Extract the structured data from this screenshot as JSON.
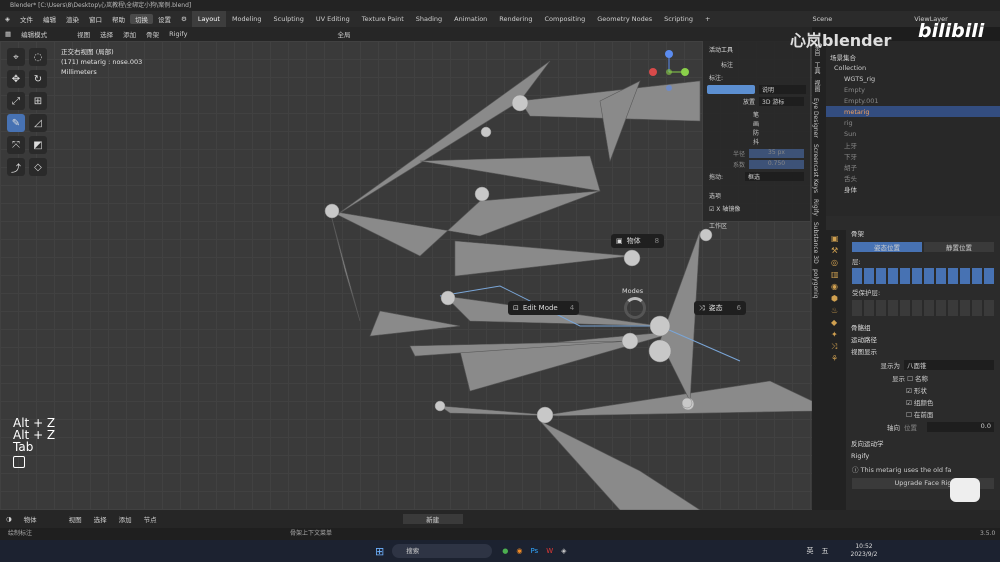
{
  "title": "Blender* [C:\\Users\\8\\Desktop\\心岚教程\\全绑定小狗\\案例.blend]",
  "menus": [
    "文件",
    "编辑",
    "渲染",
    "窗口",
    "帮助"
  ],
  "active_menu": "切换",
  "settings": "设置",
  "workspaces": [
    "Layout",
    "Modeling",
    "Sculpting",
    "UV Editing",
    "Texture Paint",
    "Shading",
    "Animation",
    "Rendering",
    "Compositing",
    "Geometry Nodes",
    "Scripting"
  ],
  "active_workspace": "Layout",
  "scene": "Scene",
  "view_layer": "ViewLayer",
  "header3d": {
    "mode": "编辑模式",
    "items": [
      "视图",
      "选择",
      "添加",
      "骨架",
      "Rigify"
    ],
    "transform": "全局"
  },
  "viewport": {
    "view_name": "正交右视图 (局部)",
    "object_line": "(171) metarig : nose.003",
    "units": "Millimeters",
    "keys": [
      "Alt + Z",
      "Alt + Z",
      "Tab"
    ]
  },
  "pie": {
    "title": "Modes",
    "object": "物体",
    "object_key": "8",
    "edit": "Edit Mode",
    "edit_key": "4",
    "pose": "姿态",
    "pose_key": "6"
  },
  "npanel": {
    "active_tool": "活动工具",
    "annotate": "标注",
    "label": "标注:",
    "mode_label": "说明",
    "placement_label": "放置",
    "placement": "3D 游标",
    "stabilize": "笔画防抖",
    "radius_label": "半径",
    "radius": "35 px",
    "factor_label": "系数",
    "factor": "0.750",
    "drag_label": "拖动:",
    "drag": "框选",
    "options": "选项",
    "x_mirror": "X 轴镜像",
    "workspace": "工作区"
  },
  "side_tabs": [
    "条目",
    "工具",
    "视图",
    "Eye Designer",
    "Screencast Keys",
    "Rigify",
    "Substance 3D",
    "polygoniq"
  ],
  "outliner": {
    "root": "场景集合",
    "rows": [
      "Collection",
      "WGTS_rig",
      "Empty",
      "Empty.001",
      "metarig",
      "rig",
      "Sun",
      "上牙",
      "下牙",
      "胡子",
      "舌头",
      "身体"
    ],
    "selected": "metarig"
  },
  "props": {
    "section": "骨架",
    "pose_btn": "姿态位置",
    "rest_btn": "静置位置",
    "layers": "层:",
    "protected": "受保护层:",
    "bone_groups": "骨骼组",
    "motion_paths": "运动路径",
    "viewport_display": "视图显示",
    "show_as_label": "显示为",
    "show_as": "八面锥",
    "show_label": "显示",
    "names": "名称",
    "shapes": "形状",
    "group_colors": "组颜色",
    "in_front": "在前面",
    "axes": "轴向",
    "position_label": "位置",
    "position": "0.0",
    "ik": "反向运动学",
    "rigify": "Rigify",
    "rigify_msg": "This metarig uses the old fa",
    "upgrade": "Upgrade Face Rig"
  },
  "bottom": {
    "mode": "物体",
    "items": [
      "视图",
      "选择",
      "添加",
      "节点"
    ],
    "new": "新建"
  },
  "status": {
    "left": "绘制标注",
    "mid": "骨架上下文菜单",
    "version": "3.5.0"
  },
  "taskbar": {
    "search": "搜索",
    "ime1": "英",
    "ime2": "五",
    "time": "10:52",
    "date": "2023/9/2"
  },
  "watermark": "心岚blender"
}
